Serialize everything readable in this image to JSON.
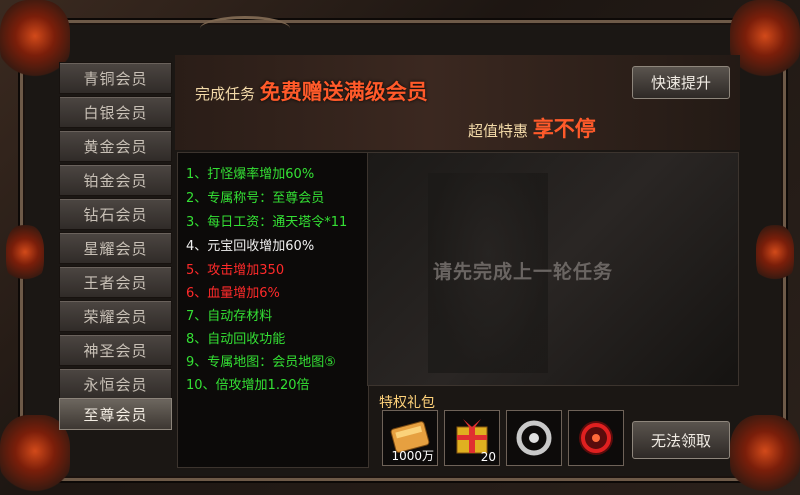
{
  "sidebar": {
    "tabs": [
      {
        "label": "青铜会员"
      },
      {
        "label": "白银会员"
      },
      {
        "label": "黄金会员"
      },
      {
        "label": "铂金会员"
      },
      {
        "label": "钻石会员"
      },
      {
        "label": "星耀会员"
      },
      {
        "label": "王者会员"
      },
      {
        "label": "荣耀会员"
      },
      {
        "label": "神圣会员"
      },
      {
        "label": "永恒会员"
      },
      {
        "label": "至尊会员"
      }
    ],
    "active_index": 10
  },
  "banner": {
    "line1_prefix": "完成任务",
    "line1_highlight": "免费赠送满级会员",
    "line2_prefix": "超值特惠",
    "line2_highlight": "享不停",
    "quick_button": "快速提升"
  },
  "benefits": [
    {
      "text": "1、打怪爆率增加60%",
      "color": "green"
    },
    {
      "text": "2、专属称号：至尊会员",
      "color": "green"
    },
    {
      "text": "3、每日工资：通天塔令*11",
      "color": "green"
    },
    {
      "text": "4、元宝回收增加60%",
      "color": "white"
    },
    {
      "text": "5、攻击增加350",
      "color": "red"
    },
    {
      "text": "6、血量增加6%",
      "color": "red"
    },
    {
      "text": "7、自动存材料",
      "color": "green"
    },
    {
      "text": "8、自动回收功能",
      "color": "green"
    },
    {
      "text": "9、专属地图：会员地图⑤",
      "color": "green"
    },
    {
      "text": "10、倍攻增加1.20倍",
      "color": "green"
    }
  ],
  "preview": {
    "overlay_text": "请先完成上一轮任务"
  },
  "gift": {
    "title": "特权礼包",
    "items": [
      {
        "icon": "gold-ingot-icon",
        "count": "1000万"
      },
      {
        "icon": "gift-box-icon",
        "count": "20"
      },
      {
        "icon": "silver-dragon-emblem-icon",
        "count": ""
      },
      {
        "icon": "red-dragon-emblem-icon",
        "count": ""
      }
    ],
    "claim_button": "无法领取"
  },
  "colors": {
    "green": "#34e034",
    "red": "#ff2a2a",
    "white": "#f0f0f0",
    "highlight": "#ff5a2a",
    "gold_text": "#ffd27a"
  }
}
